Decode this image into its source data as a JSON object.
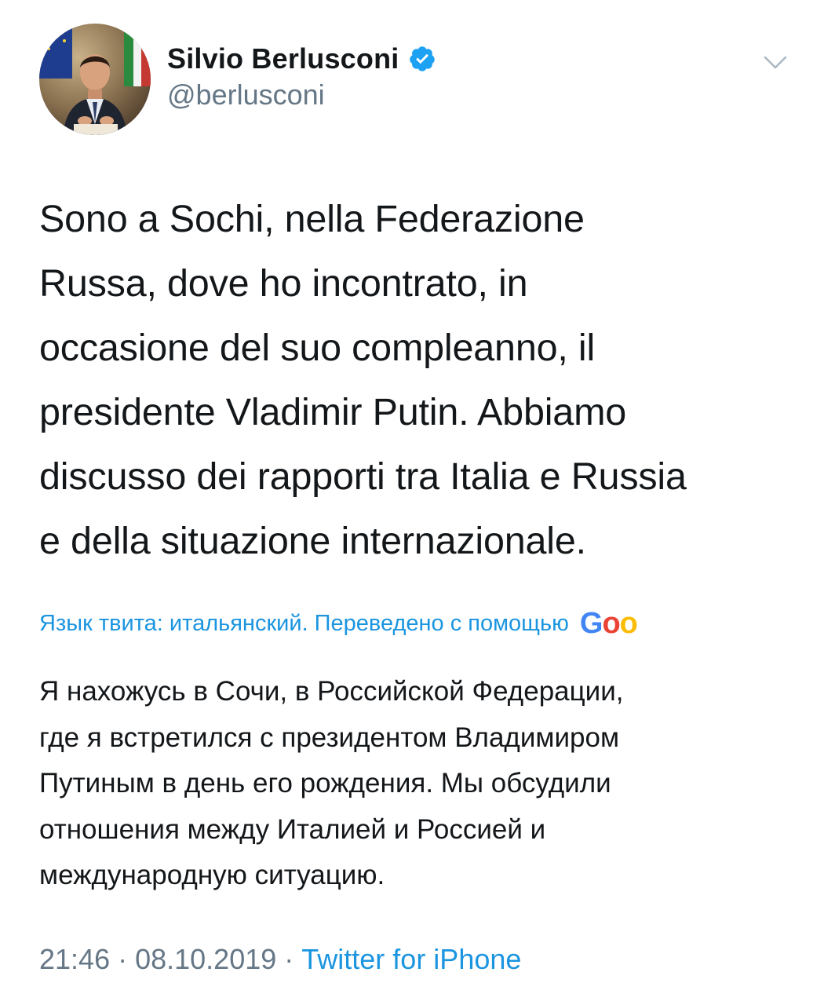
{
  "author": {
    "display_name": "Silvio Berlusconi",
    "handle": "@berlusconi",
    "verified": true,
    "verified_color": "#1da1f2"
  },
  "tweet": {
    "text": "Sono a Sochi, nella Federazione\nRussa, dove ho incontrato, in\noccasione del suo compleanno, il\npresidente Vladimir Putin. Abbiamo\ndiscusso dei rapporti tra Italia e Russia\ne della situazione internazionale.",
    "translation_label": "Язык твита: итальянский. Переведено с помощью",
    "translation_provider": "Google",
    "translation_provider_visible": "Goo",
    "translated_text": "Я нахожусь в Сочи, в Российской Федерации,\nгде я встретился с президентом Владимиром\nПутиным в день его рождения. Мы обсудили\nотношения между Италией и Россией и\nмеждународную ситуацию.",
    "time": "21:46",
    "date": "08.10.2019",
    "source": "Twitter for iPhone",
    "separator": "·"
  },
  "icons": {
    "avatar": "profile-photo",
    "verified": "verified-badge-icon",
    "menu": "chevron-down-icon",
    "provider": "google-logo"
  },
  "colors": {
    "text": "#14171a",
    "secondary": "#657786",
    "link": "#1b95e0",
    "google_blue": "#4285f4",
    "google_red": "#ea4335",
    "google_yellow": "#fbbc05"
  }
}
